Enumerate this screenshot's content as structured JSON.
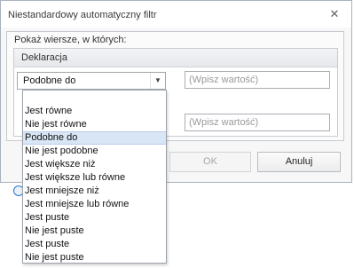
{
  "window": {
    "title": "Niestandardowy automatyczny filtr",
    "close_glyph": "✕"
  },
  "section": {
    "label": "Pokaż wiersze, w których:",
    "header": "Deklaracja"
  },
  "condition1": {
    "operator": "Podobne do",
    "value_placeholder": "(Wpisz wartość)"
  },
  "condition2": {
    "value_placeholder": "(Wpisz wartość)"
  },
  "buttons": {
    "ok": "OK",
    "cancel": "Anuluj"
  },
  "dropdown": {
    "selected_index": 2,
    "items": [
      "Jest równe",
      "Nie jest równe",
      "Podobne do",
      "Nie jest podobne",
      "Jest większe niż",
      "Jest większe lub równe",
      "Jest mniejsze niż",
      "Jest mniejsze lub równe",
      "Jest puste",
      "Nie jest puste",
      "Jest puste",
      "Nie jest puste"
    ]
  }
}
